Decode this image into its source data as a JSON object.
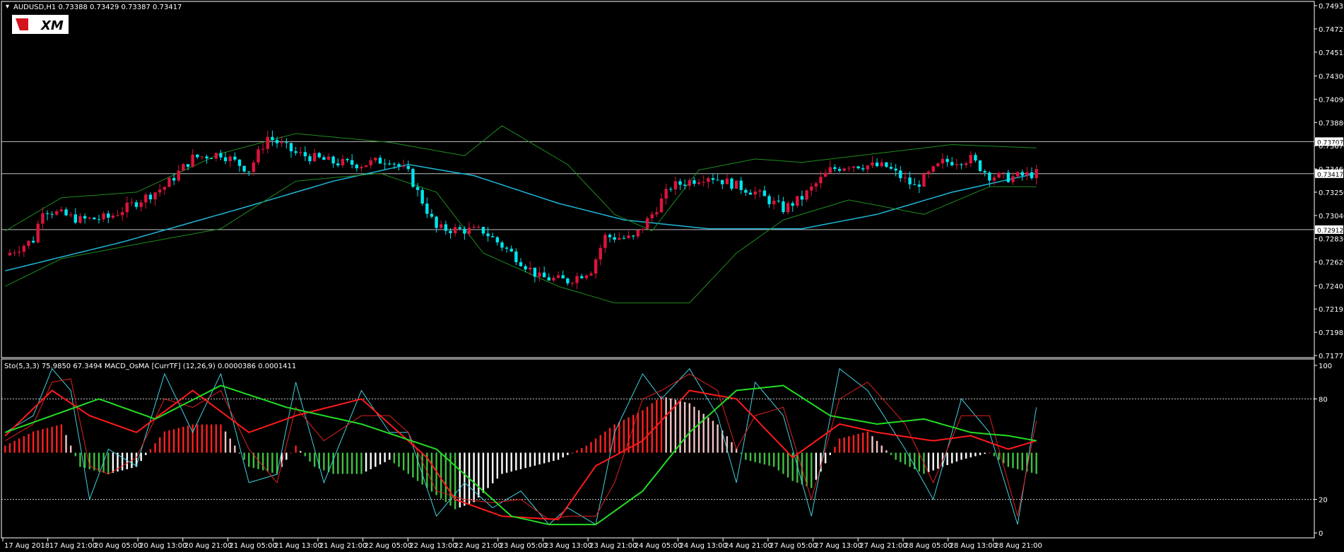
{
  "header": {
    "symbol_line": "AUDUSD,H1  0.73388 0.73429 0.73387 0.73417",
    "indicator_line": "Sto(5,3,3) 75.9850 67.3494  MACD_OsMA [CurrTF] (12,26,9) 0.0000386 0.0001411",
    "logo_text": "XM"
  },
  "colors": {
    "background": "#000000",
    "bull_candle": "#dc143c",
    "bear_candle": "#00e5ee",
    "bollinger": "#1e8c1e",
    "ma_line": "#1fb6d8",
    "hline": "#c0c0c0",
    "sto_main": "#40d0e0",
    "sto_signal": "#e02020",
    "macd_main": "#ff1a1a",
    "macd_signal": "#22dd22",
    "osma_up_up": "#ff2020",
    "osma_up_down": "#f4c4c4",
    "osma_down_down": "#40c040",
    "osma_down_up": "#ffffff"
  },
  "chart_data": [
    {
      "type": "candlestick",
      "title": "AUDUSD,H1",
      "ylim": [
        0.71775,
        0.74935
      ],
      "y_ticks": [
        "0.74935",
        "0.74725",
        "0.74515",
        "0.74300",
        "0.74090",
        "0.73880",
        "0.73670",
        "0.73460",
        "0.73250",
        "0.73040",
        "0.72830",
        "0.72620",
        "0.72405",
        "0.72195",
        "0.71985",
        "0.71775"
      ],
      "x_ticks": [
        "17 Aug 2018",
        "17 Aug 21:00",
        "20 Aug 05:00",
        "20 Aug 13:00",
        "20 Aug 21:00",
        "21 Aug 05:00",
        "21 Aug 13:00",
        "21 Aug 21:00",
        "22 Aug 05:00",
        "22 Aug 13:00",
        "22 Aug 21:00",
        "23 Aug 05:00",
        "23 Aug 13:00",
        "23 Aug 21:00",
        "24 Aug 05:00",
        "24 Aug 13:00",
        "24 Aug 21:00",
        "27 Aug 05:00",
        "27 Aug 13:00",
        "27 Aug 21:00",
        "28 Aug 05:00",
        "28 Aug 13:00",
        "28 Aug 21:00"
      ],
      "horizontal_lines": [
        {
          "value": 0.73707,
          "label": "0.73707"
        },
        {
          "value": 0.73417,
          "label": "0.73417"
        },
        {
          "value": 0.72912,
          "label": "0.72912"
        }
      ],
      "close_waypoints": [
        [
          0,
          0.7268
        ],
        [
          6,
          0.7282
        ],
        [
          8,
          0.731
        ],
        [
          16,
          0.73
        ],
        [
          22,
          0.7302
        ],
        [
          34,
          0.733
        ],
        [
          40,
          0.7356
        ],
        [
          46,
          0.736
        ],
        [
          52,
          0.7345
        ],
        [
          56,
          0.7375
        ],
        [
          62,
          0.736
        ],
        [
          70,
          0.7352
        ],
        [
          76,
          0.735
        ],
        [
          82,
          0.7355
        ],
        [
          86,
          0.7342
        ],
        [
          88,
          0.7325
        ],
        [
          92,
          0.7292
        ],
        [
          102,
          0.729
        ],
        [
          108,
          0.727
        ],
        [
          114,
          0.7248
        ],
        [
          120,
          0.7245
        ],
        [
          125,
          0.7255
        ],
        [
          128,
          0.7285
        ],
        [
          134,
          0.7283
        ],
        [
          138,
          0.7305
        ],
        [
          142,
          0.733
        ],
        [
          150,
          0.734
        ],
        [
          160,
          0.7325
        ],
        [
          166,
          0.731
        ],
        [
          170,
          0.732
        ],
        [
          176,
          0.7345
        ],
        [
          180,
          0.735
        ],
        [
          188,
          0.7348
        ],
        [
          194,
          0.733
        ],
        [
          200,
          0.7352
        ],
        [
          206,
          0.7355
        ],
        [
          210,
          0.734
        ],
        [
          214,
          0.7338
        ],
        [
          220,
          0.7342
        ]
      ],
      "series": [
        {
          "name": "MA",
          "values": [
            [
              0,
              0.7254
            ],
            [
              25,
              0.728
            ],
            [
              50,
              0.731
            ],
            [
              70,
              0.7335
            ],
            [
              86,
              0.735
            ],
            [
              100,
              0.734
            ],
            [
              118,
              0.7315
            ],
            [
              132,
              0.73
            ],
            [
              150,
              0.7292
            ],
            [
              170,
              0.7292
            ],
            [
              186,
              0.7305
            ],
            [
              202,
              0.7325
            ],
            [
              220,
              0.7342
            ]
          ]
        },
        {
          "name": "BB upper",
          "values": [
            [
              0,
              0.729
            ],
            [
              12,
              0.732
            ],
            [
              28,
              0.7325
            ],
            [
              46,
              0.736
            ],
            [
              62,
              0.7378
            ],
            [
              82,
              0.737
            ],
            [
              98,
              0.7358
            ],
            [
              106,
              0.7385
            ],
            [
              120,
              0.735
            ],
            [
              130,
              0.7305
            ],
            [
              138,
              0.729
            ],
            [
              148,
              0.7345
            ],
            [
              160,
              0.7355
            ],
            [
              170,
              0.7352
            ],
            [
              186,
              0.736
            ],
            [
              202,
              0.7368
            ],
            [
              220,
              0.7365
            ]
          ]
        },
        {
          "name": "BB lower",
          "values": [
            [
              0,
              0.724
            ],
            [
              12,
              0.7265
            ],
            [
              28,
              0.7278
            ],
            [
              46,
              0.7292
            ],
            [
              62,
              0.7335
            ],
            [
              80,
              0.7342
            ],
            [
              92,
              0.7325
            ],
            [
              102,
              0.727
            ],
            [
              118,
              0.724
            ],
            [
              130,
              0.7225
            ],
            [
              146,
              0.7225
            ],
            [
              156,
              0.727
            ],
            [
              166,
              0.73
            ],
            [
              180,
              0.7318
            ],
            [
              196,
              0.7305
            ],
            [
              210,
              0.733
            ],
            [
              220,
              0.733
            ]
          ]
        }
      ]
    },
    {
      "type": "oscillator",
      "title": "Sto(5,3,3) / MACD_OsMA [CurrTF] (12,26,9)",
      "ylim": [
        0,
        100
      ],
      "y_ticks": [
        "100",
        "80",
        "20",
        "0"
      ],
      "levels": [
        80,
        20
      ],
      "series": [
        {
          "name": "Sto main",
          "values": [
            [
              0,
              60
            ],
            [
              6,
              70
            ],
            [
              10,
              98
            ],
            [
              14,
              85
            ],
            [
              18,
              20
            ],
            [
              22,
              50
            ],
            [
              28,
              40
            ],
            [
              34,
              95
            ],
            [
              40,
              60
            ],
            [
              46,
              95
            ],
            [
              52,
              30
            ],
            [
              58,
              35
            ],
            [
              62,
              90
            ],
            [
              68,
              30
            ],
            [
              76,
              85
            ],
            [
              82,
              60
            ],
            [
              86,
              60
            ],
            [
              92,
              10
            ],
            [
              98,
              30
            ],
            [
              104,
              15
            ],
            [
              110,
              25
            ],
            [
              116,
              5
            ],
            [
              120,
              15
            ],
            [
              126,
              5
            ],
            [
              130,
              60
            ],
            [
              136,
              95
            ],
            [
              140,
              80
            ],
            [
              146,
              98
            ],
            [
              152,
              70
            ],
            [
              156,
              30
            ],
            [
              160,
              90
            ],
            [
              166,
              70
            ],
            [
              172,
              10
            ],
            [
              178,
              98
            ],
            [
              184,
              85
            ],
            [
              192,
              50
            ],
            [
              198,
              20
            ],
            [
              204,
              80
            ],
            [
              210,
              60
            ],
            [
              216,
              5
            ],
            [
              220,
              75
            ]
          ]
        },
        {
          "name": "Sto signal",
          "values": [
            [
              0,
              55
            ],
            [
              6,
              65
            ],
            [
              10,
              90
            ],
            [
              14,
              92
            ],
            [
              18,
              40
            ],
            [
              22,
              35
            ],
            [
              28,
              45
            ],
            [
              34,
              80
            ],
            [
              40,
              75
            ],
            [
              46,
              85
            ],
            [
              52,
              50
            ],
            [
              58,
              30
            ],
            [
              62,
              75
            ],
            [
              68,
              55
            ],
            [
              76,
              70
            ],
            [
              82,
              70
            ],
            [
              86,
              60
            ],
            [
              92,
              25
            ],
            [
              98,
              20
            ],
            [
              104,
              18
            ],
            [
              110,
              20
            ],
            [
              116,
              8
            ],
            [
              120,
              10
            ],
            [
              126,
              10
            ],
            [
              130,
              30
            ],
            [
              136,
              80
            ],
            [
              140,
              85
            ],
            [
              146,
              95
            ],
            [
              152,
              85
            ],
            [
              156,
              50
            ],
            [
              160,
              70
            ],
            [
              166,
              75
            ],
            [
              172,
              20
            ],
            [
              178,
              80
            ],
            [
              184,
              90
            ],
            [
              192,
              65
            ],
            [
              198,
              30
            ],
            [
              204,
              70
            ],
            [
              210,
              70
            ],
            [
              216,
              10
            ],
            [
              220,
              67
            ]
          ]
        },
        {
          "name": "MACD main",
          "values": [
            [
              0,
              58
            ],
            [
              10,
              85
            ],
            [
              18,
              70
            ],
            [
              28,
              60
            ],
            [
              40,
              85
            ],
            [
              52,
              60
            ],
            [
              62,
              70
            ],
            [
              76,
              80
            ],
            [
              90,
              45
            ],
            [
              96,
              20
            ],
            [
              106,
              10
            ],
            [
              118,
              8
            ],
            [
              126,
              40
            ],
            [
              136,
              55
            ],
            [
              146,
              85
            ],
            [
              156,
              80
            ],
            [
              168,
              45
            ],
            [
              178,
              65
            ],
            [
              186,
              60
            ],
            [
              198,
              55
            ],
            [
              206,
              58
            ],
            [
              214,
              50
            ],
            [
              220,
              55
            ]
          ]
        },
        {
          "name": "MACD signal",
          "values": [
            [
              0,
              60
            ],
            [
              10,
              70
            ],
            [
              20,
              80
            ],
            [
              32,
              68
            ],
            [
              46,
              88
            ],
            [
              60,
              75
            ],
            [
              76,
              65
            ],
            [
              92,
              50
            ],
            [
              100,
              30
            ],
            [
              108,
              10
            ],
            [
              116,
              5
            ],
            [
              126,
              5
            ],
            [
              136,
              25
            ],
            [
              146,
              60
            ],
            [
              156,
              85
            ],
            [
              166,
              88
            ],
            [
              176,
              70
            ],
            [
              186,
              65
            ],
            [
              196,
              68
            ],
            [
              206,
              60
            ],
            [
              214,
              58
            ],
            [
              220,
              55
            ]
          ]
        }
      ],
      "osma": [
        [
          0,
          1
        ],
        [
          6,
          3
        ],
        [
          12,
          4
        ],
        [
          16,
          -2
        ],
        [
          22,
          -3
        ],
        [
          28,
          -2
        ],
        [
          34,
          3
        ],
        [
          40,
          4
        ],
        [
          46,
          4
        ],
        [
          52,
          -2
        ],
        [
          58,
          -3
        ],
        [
          62,
          1
        ],
        [
          66,
          -2
        ],
        [
          70,
          -3
        ],
        [
          76,
          -3
        ],
        [
          82,
          -1
        ],
        [
          86,
          -3
        ],
        [
          92,
          -6
        ],
        [
          96,
          -8
        ],
        [
          100,
          -7
        ],
        [
          106,
          -3
        ],
        [
          112,
          -2
        ],
        [
          118,
          -1
        ],
        [
          124,
          1
        ],
        [
          130,
          4
        ],
        [
          136,
          6
        ],
        [
          140,
          8
        ],
        [
          146,
          7
        ],
        [
          152,
          4
        ],
        [
          158,
          -1
        ],
        [
          164,
          -2
        ],
        [
          168,
          -4
        ],
        [
          172,
          -5
        ],
        [
          178,
          2
        ],
        [
          184,
          3
        ],
        [
          190,
          -1
        ],
        [
          196,
          -3
        ],
        [
          204,
          -1
        ],
        [
          210,
          0
        ],
        [
          214,
          -2
        ],
        [
          220,
          -3
        ]
      ]
    }
  ]
}
